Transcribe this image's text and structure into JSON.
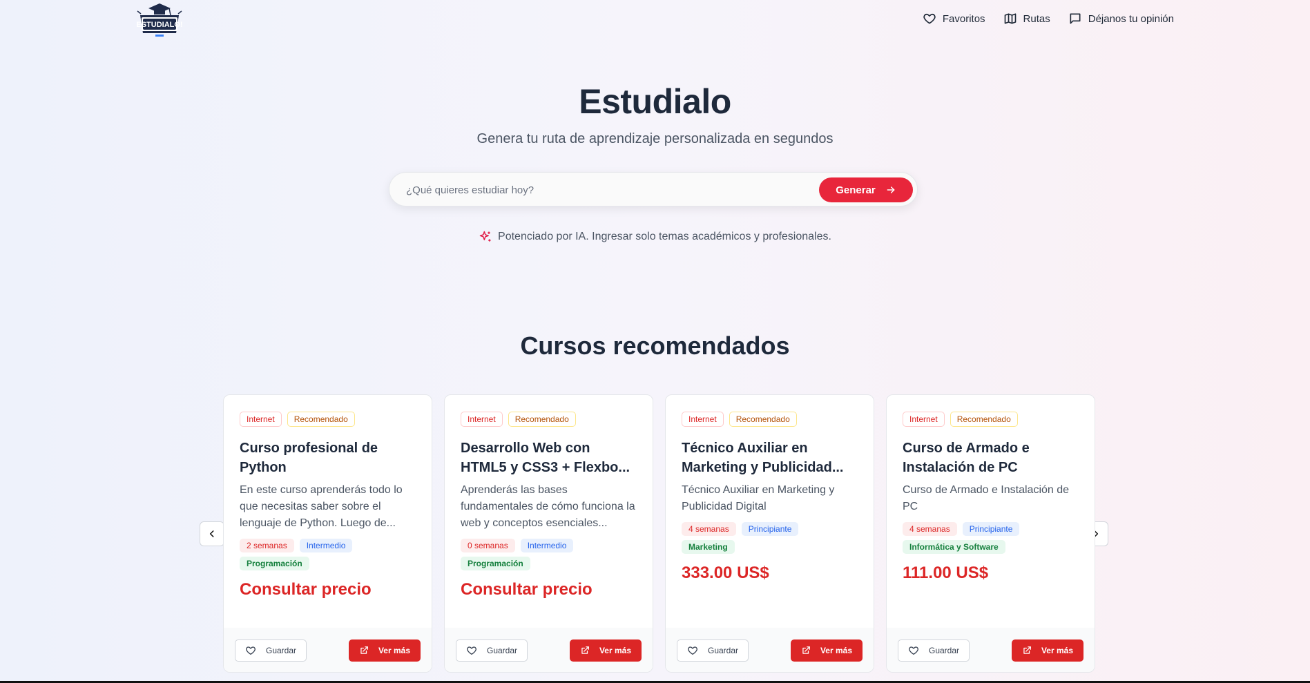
{
  "brand": {
    "logo_text": "ESTUDIALO!"
  },
  "nav": {
    "items": [
      {
        "label": "Favoritos",
        "icon": "heart-icon"
      },
      {
        "label": "Rutas",
        "icon": "map-icon"
      },
      {
        "label": "Déjanos tu opinión",
        "icon": "message-icon"
      }
    ]
  },
  "hero": {
    "title": "Estudialo",
    "subtitle": "Genera tu ruta de aprendizaje personalizada en segundos",
    "search_placeholder": "¿Qué quieres estudiar hoy?",
    "search_value": "",
    "generate_label": "Generar",
    "ai_note": "Potenciado por IA. Ingresar solo temas académicos y profesionales."
  },
  "section": {
    "title": "Cursos recomendados"
  },
  "colors": {
    "accent": "#dc2626",
    "accent_button": "#e8263b",
    "level": "#2563eb",
    "category": "#15803d"
  },
  "cards": [
    {
      "tag_source": "Internet",
      "tag_badge": "Recomendado",
      "title": "Curso profesional de Python",
      "description": "En este curso aprenderás todo lo que necesitas saber sobre el lenguaje de Python. Luego de...",
      "duration": "2 semanas",
      "level": "Intermedio",
      "category": "Programación",
      "price": "Consultar precio",
      "save_label": "Guardar",
      "more_label": "Ver más"
    },
    {
      "tag_source": "Internet",
      "tag_badge": "Recomendado",
      "title": "Desarrollo Web con HTML5 y CSS3 + Flexbo...",
      "description": "Aprenderás las bases fundamentales de cómo funciona la web y conceptos esenciales...",
      "duration": "0 semanas",
      "level": "Intermedio",
      "category": "Programación",
      "price": "Consultar precio",
      "save_label": "Guardar",
      "more_label": "Ver más"
    },
    {
      "tag_source": "Internet",
      "tag_badge": "Recomendado",
      "title": "Técnico Auxiliar en Marketing y Publicidad...",
      "description": "Técnico Auxiliar en Marketing y Publicidad Digital",
      "duration": "4 semanas",
      "level": "Principiante",
      "category": "Marketing",
      "price": "333.00 US$",
      "save_label": "Guardar",
      "more_label": "Ver más"
    },
    {
      "tag_source": "Internet",
      "tag_badge": "Recomendado",
      "title": "Curso de Armado e Instalación de PC",
      "description": "Curso de Armado e Instalación de PC",
      "duration": "4 semanas",
      "level": "Principiante",
      "category": "Informática y Software",
      "price": "111.00 US$",
      "save_label": "Guardar",
      "more_label": "Ver más"
    }
  ]
}
